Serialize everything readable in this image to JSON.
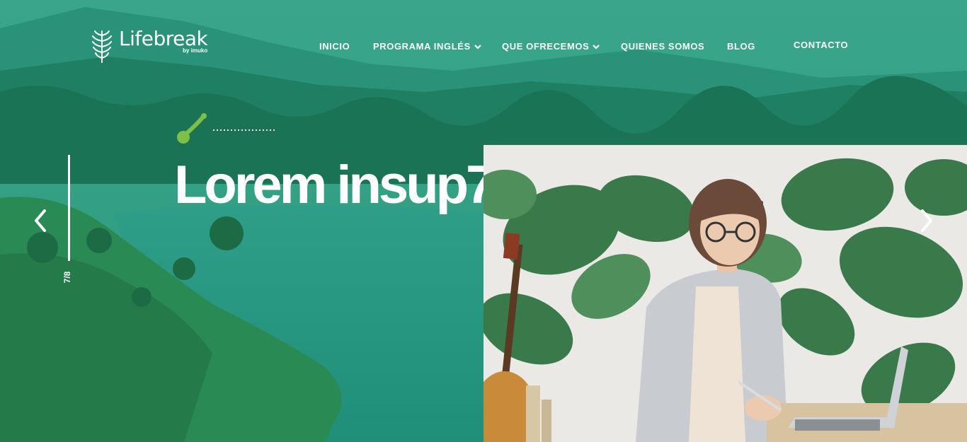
{
  "brand": {
    "name": "Lifebreak",
    "byline": "by imuko"
  },
  "nav": {
    "items": [
      {
        "label": "INICIO",
        "has_dropdown": false
      },
      {
        "label": "PROGRAMA INGLÉS",
        "has_dropdown": true
      },
      {
        "label": "QUE OFRECEMOS",
        "has_dropdown": true
      },
      {
        "label": "QUIENES SOMOS",
        "has_dropdown": false
      },
      {
        "label": "BLOG",
        "has_dropdown": false
      },
      {
        "label": "CONTACTO",
        "has_dropdown": false
      }
    ]
  },
  "hero": {
    "title": "Lorem insup7",
    "slide_counter": "7/8"
  },
  "colors": {
    "overlay_green": "#1f8a6a",
    "accent_lime": "#7cc04a",
    "text": "#ffffff"
  },
  "icons": {
    "prev": "chevron-left-icon",
    "next": "chevron-right-icon",
    "dropdown": "chevron-down-icon",
    "logo": "wheat-leaf-icon",
    "decor": "lime-stroke-icon"
  }
}
